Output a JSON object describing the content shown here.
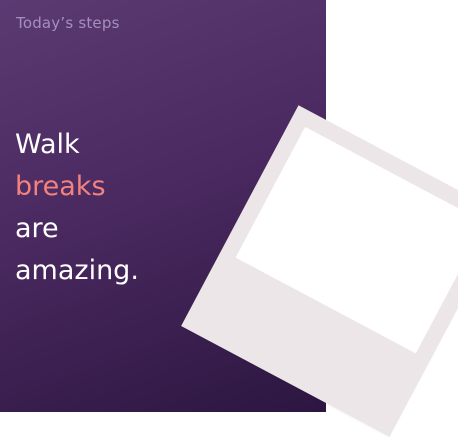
{
  "card": {
    "kicker": "Today’s steps",
    "headline": {
      "line1": "Walk",
      "line2": "breaks",
      "line3": "are",
      "line4": "amazing."
    }
  },
  "colors": {
    "card_gradient_start": "#5b3a72",
    "card_gradient_end": "#2c1640",
    "accent": "#f3827e",
    "text": "#ffffff",
    "kicker": "#a58fbc",
    "photo_frame": "#ece6e8",
    "photo_area": "#ffffff"
  }
}
